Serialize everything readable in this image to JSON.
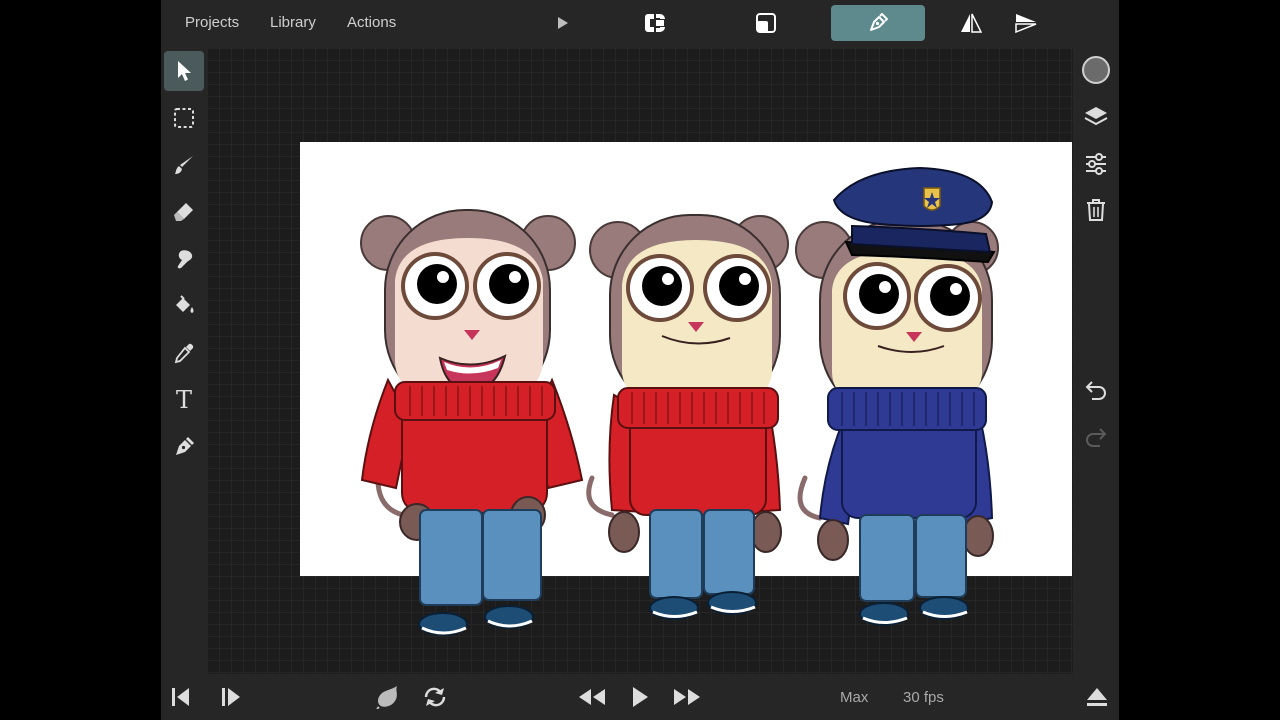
{
  "topbar": {
    "menu": [
      "Projects",
      "Library",
      "Actions"
    ],
    "play_icon": "play-icon",
    "buttons": [
      "onion-skin-icon",
      "crop-icon",
      "pen-mode-icon",
      "flip-horizontal-icon",
      "flip-vertical-icon"
    ]
  },
  "left_tools": [
    "select-arrow-icon",
    "marquee-select-icon",
    "brush-icon",
    "eraser-icon",
    "smudge-icon",
    "paint-bucket-icon",
    "eyedropper-icon",
    "text-tool-icon",
    "pen-tool-icon"
  ],
  "left_tools_text_glyph": "T",
  "right_tools": [
    "color-swatch-icon",
    "layers-icon",
    "adjustments-icon",
    "trash-icon",
    "undo-icon",
    "redo-icon"
  ],
  "colors": {
    "accent": "#5e8a8e",
    "color_swatch": "#6b6b6b",
    "sweater_red": "#d42026",
    "sweater_blue": "#2e3a94",
    "jeans": "#5a90bd",
    "fur": "#9a7b7b",
    "face": "#f4e9c4",
    "police_cap": "#25377a"
  },
  "bottombar": {
    "zoom_label": "Max",
    "fps_label": "30 fps"
  },
  "characters": [
    {
      "outfit": "red sweater",
      "expression": "smiling"
    },
    {
      "outfit": "red sweater",
      "expression": "neutral"
    },
    {
      "outfit": "police uniform",
      "expression": "neutral"
    }
  ]
}
